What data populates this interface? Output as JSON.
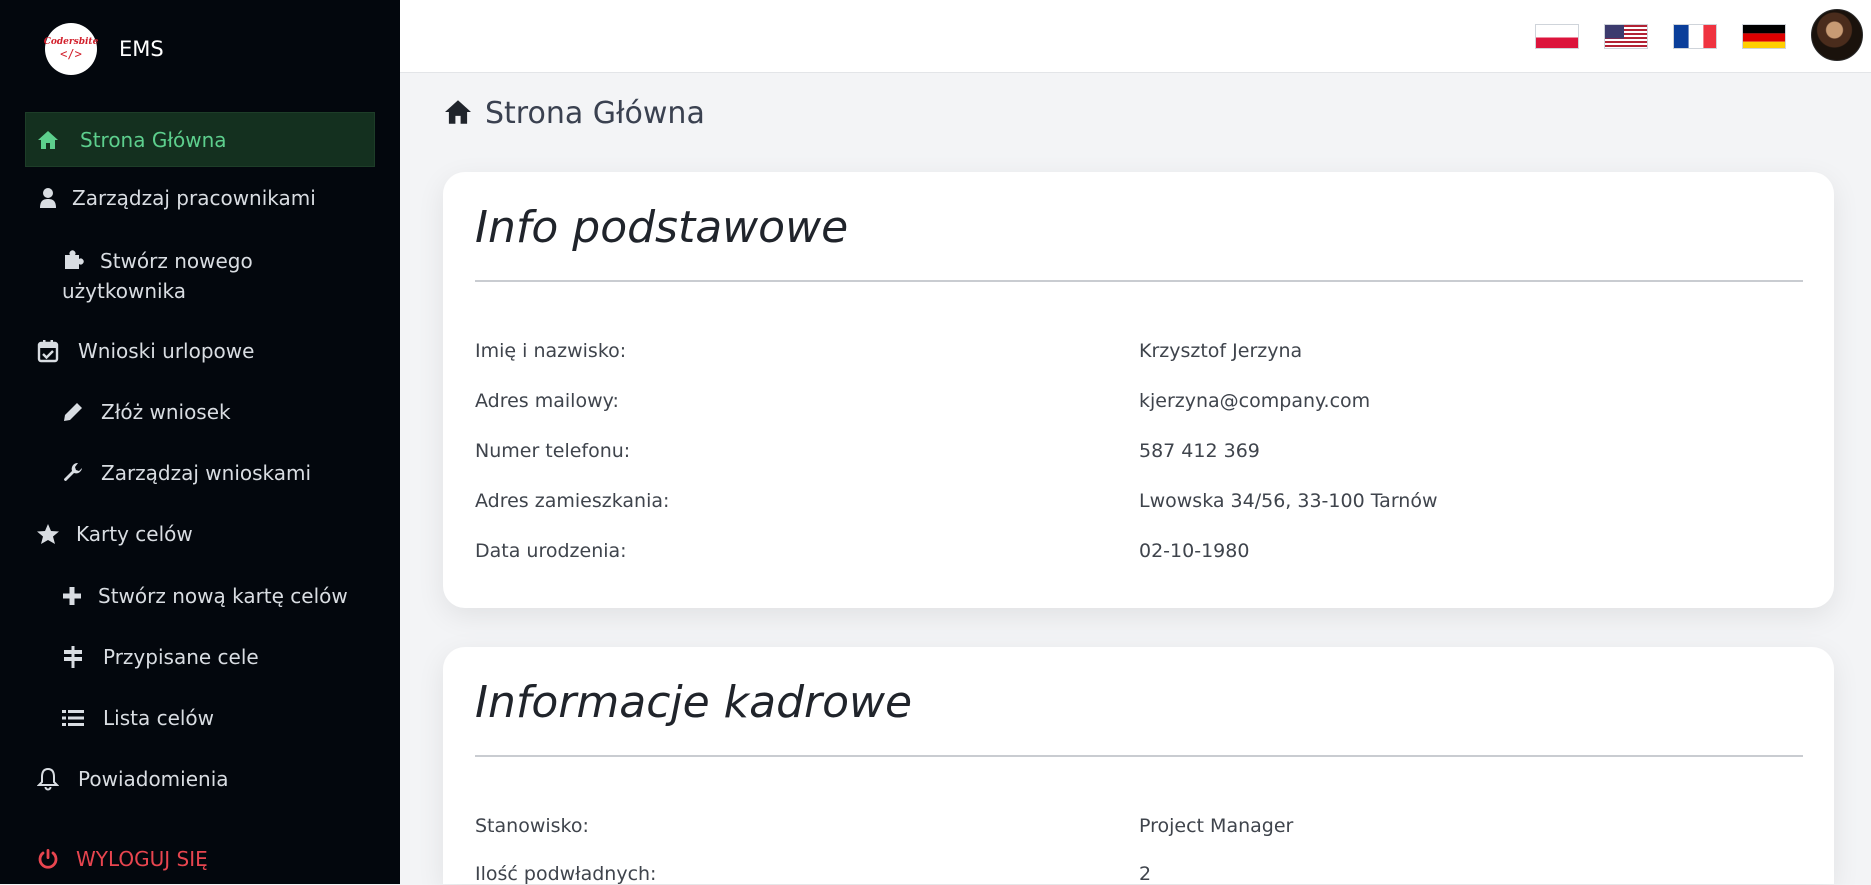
{
  "app": {
    "name": "EMS",
    "logo_line1": "Codersbite",
    "logo_line2": "</>"
  },
  "sidebar": {
    "items": [
      {
        "label": "Strona Główna"
      },
      {
        "label": "Zarządzaj pracownikami"
      },
      {
        "label": "Stwórz nowego użytkownika"
      },
      {
        "label": "Wnioski urlopowe"
      },
      {
        "label": "Złóż wniosek"
      },
      {
        "label": "Zarządzaj wnioskami"
      },
      {
        "label": "Karty celów"
      },
      {
        "label": "Stwórz nową kartę celów"
      },
      {
        "label": "Przypisane cele"
      },
      {
        "label": "Lista celów"
      },
      {
        "label": "Powiadomienia"
      }
    ],
    "logout": "WYLOGUJ SIĘ"
  },
  "topbar": {
    "flags": [
      "Polish",
      "English (US)",
      "French",
      "German"
    ]
  },
  "page": {
    "title": "Strona Główna"
  },
  "basic_info": {
    "heading": "Info podstawowe",
    "rows": [
      {
        "label": "Imię i nazwisko:",
        "value": "Krzysztof Jerzyna"
      },
      {
        "label": "Adres mailowy:",
        "value": "kjerzyna@company.com"
      },
      {
        "label": "Numer telefonu:",
        "value": "587 412 369"
      },
      {
        "label": "Adres zamieszkania:",
        "value": "Lwowska 34/56, 33-100 Tarnów"
      },
      {
        "label": "Data urodzenia:",
        "value": "02-10-1980"
      }
    ]
  },
  "hr_info": {
    "heading": "Informacje kadrowe",
    "rows": [
      {
        "label": "Stanowisko:",
        "value": "Project Manager"
      },
      {
        "label": "Ilość podwładnych:",
        "value": "2"
      }
    ]
  },
  "colors": {
    "sidebar_bg": "#03070d",
    "active_bg": "#14301f",
    "active_text": "#5dcf8d",
    "logout": "#e8454f"
  }
}
